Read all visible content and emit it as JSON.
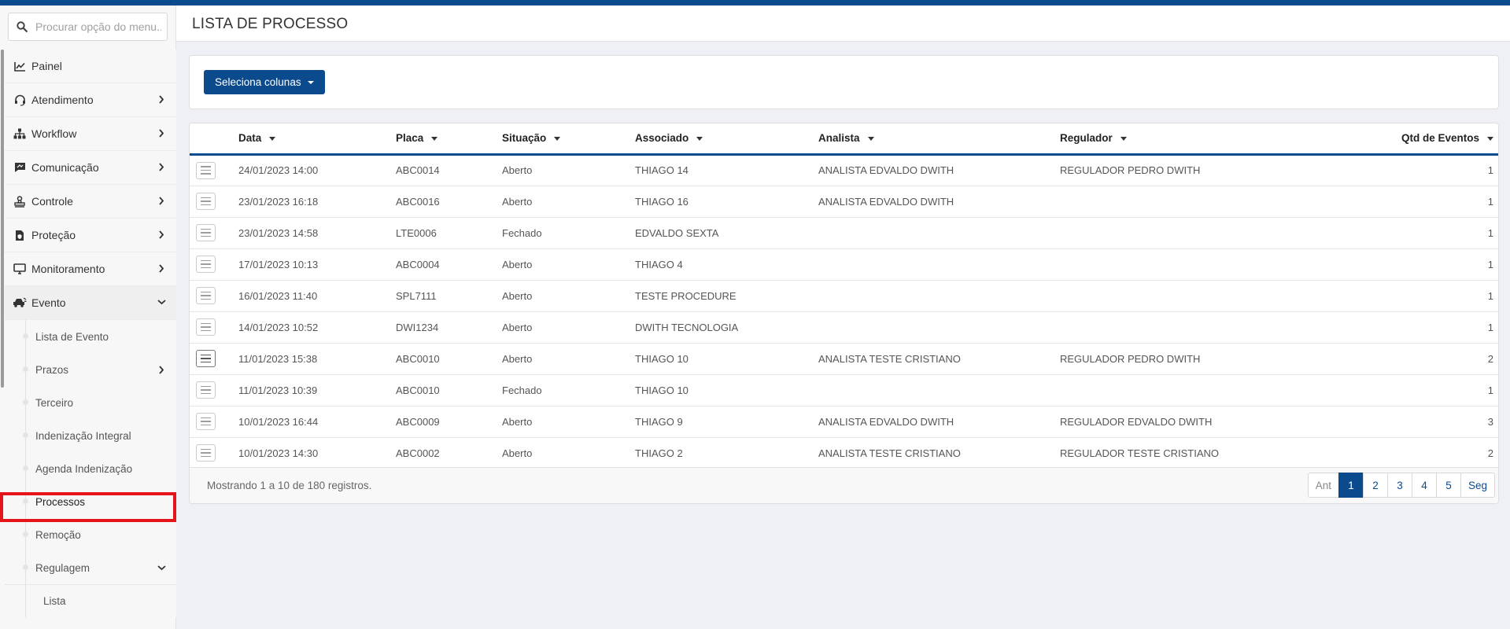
{
  "header": {
    "title": "LISTA DE PROCESSO"
  },
  "search": {
    "placeholder": "Procurar opção do menu..."
  },
  "sidebar": {
    "items": [
      {
        "label": "Painel",
        "icon": "chart-line-icon"
      },
      {
        "label": "Atendimento",
        "icon": "headset-icon"
      },
      {
        "label": "Workflow",
        "icon": "sitemap-icon"
      },
      {
        "label": "Comunicação",
        "icon": "chat-icon"
      },
      {
        "label": "Controle",
        "icon": "stamp-icon"
      },
      {
        "label": "Proteção",
        "icon": "file-shield-icon"
      },
      {
        "label": "Monitoramento",
        "icon": "monitor-icon"
      },
      {
        "label": "Evento",
        "icon": "car-crash-icon"
      }
    ],
    "submenu": [
      {
        "label": "Lista de Evento"
      },
      {
        "label": "Prazos"
      },
      {
        "label": "Terceiro"
      },
      {
        "label": "Indenização Integral"
      },
      {
        "label": "Agenda Indenização"
      },
      {
        "label": "Processos"
      },
      {
        "label": "Remoção"
      },
      {
        "label": "Regulagem"
      }
    ],
    "subsubmenu": [
      {
        "label": "Lista"
      }
    ]
  },
  "toolbar": {
    "columns_button": "Seleciona colunas"
  },
  "table": {
    "headers": {
      "data": "Data",
      "placa": "Placa",
      "situacao": "Situação",
      "associado": "Associado",
      "analista": "Analista",
      "regulador": "Regulador",
      "qtd": "Qtd de Eventos"
    },
    "rows": [
      {
        "data": "24/01/2023 14:00",
        "placa": "ABC0014",
        "situacao": "Aberto",
        "associado": "THIAGO 14",
        "analista": "ANALISTA EDVALDO DWITH",
        "regulador": "REGULADOR PEDRO DWITH",
        "qtd": "1"
      },
      {
        "data": "23/01/2023 16:18",
        "placa": "ABC0016",
        "situacao": "Aberto",
        "associado": "THIAGO 16",
        "analista": "ANALISTA EDVALDO DWITH",
        "regulador": "",
        "qtd": "1"
      },
      {
        "data": "23/01/2023 14:58",
        "placa": "LTE0006",
        "situacao": "Fechado",
        "associado": "EDVALDO SEXTA",
        "analista": "",
        "regulador": "",
        "qtd": "1"
      },
      {
        "data": "17/01/2023 10:13",
        "placa": "ABC0004",
        "situacao": "Aberto",
        "associado": "THIAGO 4",
        "analista": "",
        "regulador": "",
        "qtd": "1"
      },
      {
        "data": "16/01/2023 11:40",
        "placa": "SPL7111",
        "situacao": "Aberto",
        "associado": "TESTE PROCEDURE",
        "analista": "",
        "regulador": "",
        "qtd": "1"
      },
      {
        "data": "14/01/2023 10:52",
        "placa": "DWI1234",
        "situacao": "Aberto",
        "associado": "DWITH TECNOLOGIA",
        "analista": "",
        "regulador": "",
        "qtd": "1"
      },
      {
        "data": "11/01/2023 15:38",
        "placa": "ABC0010",
        "situacao": "Aberto",
        "associado": "THIAGO 10",
        "analista": "ANALISTA TESTE CRISTIANO",
        "regulador": "REGULADOR PEDRO DWITH",
        "qtd": "2"
      },
      {
        "data": "11/01/2023 10:39",
        "placa": "ABC0010",
        "situacao": "Fechado",
        "associado": "THIAGO 10",
        "analista": "",
        "regulador": "",
        "qtd": "1"
      },
      {
        "data": "10/01/2023 16:44",
        "placa": "ABC0009",
        "situacao": "Aberto",
        "associado": "THIAGO 9",
        "analista": "ANALISTA EDVALDO DWITH",
        "regulador": "REGULADOR EDVALDO DWITH",
        "qtd": "3"
      },
      {
        "data": "10/01/2023 14:30",
        "placa": "ABC0002",
        "situacao": "Aberto",
        "associado": "THIAGO 2",
        "analista": "ANALISTA TESTE CRISTIANO",
        "regulador": "REGULADOR TESTE CRISTIANO",
        "qtd": "2"
      }
    ]
  },
  "footer": {
    "info": "Mostrando 1 a 10 de 180 registros.",
    "pager": [
      "Ant",
      "1",
      "2",
      "3",
      "4",
      "5",
      "Seg"
    ],
    "active_page": "1"
  },
  "colors": {
    "primary": "#0b4a8c",
    "highlight": "#e5141b"
  }
}
